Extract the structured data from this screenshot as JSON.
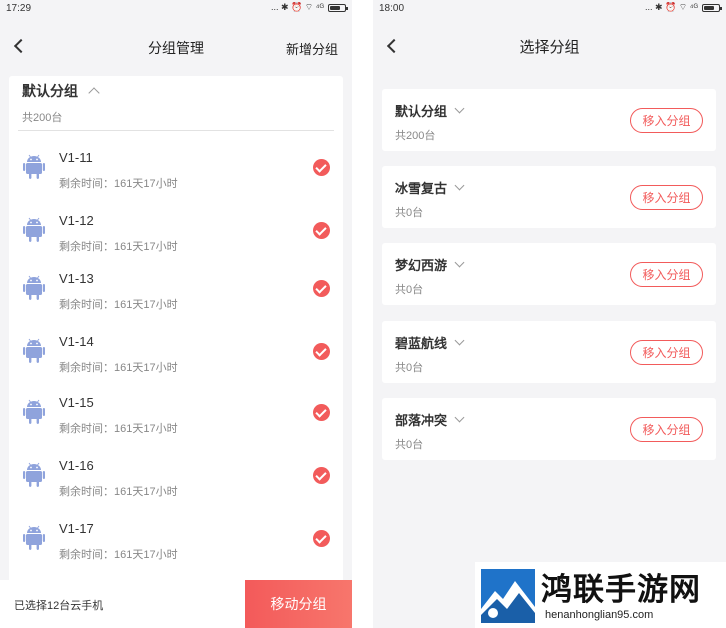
{
  "left_screen": {
    "status": {
      "time": "17:29",
      "icons_text": "... ✱ ⏰ ⌔ ⁴ᴳ"
    },
    "nav": {
      "title": "分组管理",
      "action": "新增分组"
    },
    "group": {
      "title": "默认分组",
      "count": "共200台"
    },
    "devices": [
      {
        "name": "V1-11",
        "remaining": "剩余时间：161天17小时"
      },
      {
        "name": "V1-12",
        "remaining": "剩余时间：161天17小时"
      },
      {
        "name": "V1-13",
        "remaining": "剩余时间：161天17小时"
      },
      {
        "name": "V1-14",
        "remaining": "剩余时间：161天17小时"
      },
      {
        "name": "V1-15",
        "remaining": "剩余时间：161天17小时"
      },
      {
        "name": "V1-16",
        "remaining": "剩余时间：161天17小时"
      },
      {
        "name": "V1-17",
        "remaining": "剩余时间：161天17小时"
      }
    ],
    "bottom": {
      "selected": "已选择12台云手机",
      "move_label": "移动分组"
    }
  },
  "right_screen": {
    "status": {
      "time": "18:00",
      "icons_text": "... ✱ ⏰ ⌔ ⁴ᴳ"
    },
    "nav": {
      "title": "选择分组"
    },
    "groups": [
      {
        "name": "默认分组",
        "count": "共200台",
        "action": "移入分组"
      },
      {
        "name": "冰雪复古",
        "count": "共0台",
        "action": "移入分组"
      },
      {
        "name": "梦幻西游",
        "count": "共0台",
        "action": "移入分组"
      },
      {
        "name": "碧蓝航线",
        "count": "共0台",
        "action": "移入分组"
      },
      {
        "name": "部落冲突",
        "count": "共0台",
        "action": "移入分组"
      }
    ]
  },
  "watermark": {
    "title": "鸿联手游网",
    "url": "henanhonglian95.com"
  },
  "colors": {
    "accent": "#f25b5b",
    "android": "#8fa3dc",
    "page_bg": "#f4f4f6",
    "text": "#333333",
    "muted": "#888888"
  },
  "icons": {
    "back": "chevron-left-icon",
    "device": "android-icon",
    "selected": "check-circle-icon",
    "expand": "chevron-down-icon",
    "collapse": "chevron-up-icon"
  }
}
